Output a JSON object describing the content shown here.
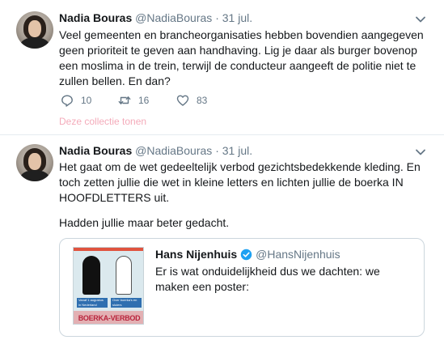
{
  "tweet1": {
    "name": "Nadia Bouras",
    "handle": "@NadiaBouras",
    "separator": "·",
    "date": "31 jul.",
    "text": "Veel gemeenten en brancheorganisaties hebben bovendien aangegeven geen prioriteit te geven aan handhaving. Lig je daar als burger bovenop een moslima in de trein, terwijl de conducteur aangeeft de politie niet te zullen bellen. En dan?",
    "replies": "10",
    "retweets": "16",
    "likes": "83",
    "collection_link": "Deze collectie tonen"
  },
  "tweet2": {
    "name": "Nadia Bouras",
    "handle": "@NadiaBouras",
    "separator": "·",
    "date": "31 jul.",
    "text_p1": "Het gaat om de wet gedeeltelijk verbod gezichtsbedekkende kleding. En toch zetten jullie die wet in kleine letters en lichten jullie de boerka IN HOOFDLETTERS uit.",
    "text_p2": "Hadden jullie maar beter gedacht.",
    "quote": {
      "name": "Hans Nijenhuis",
      "handle": "@HansNijenhuis",
      "text": "Er is wat onduidelijkheid dus we dachten: we maken een poster:",
      "poster": {
        "label_left": "Vanaf 1 augustus in Nederland",
        "label_right": "Over boerka's en sluiers",
        "banner": "BOERKA-VERBOD"
      }
    }
  },
  "icons": {
    "reply": "reply-icon",
    "retweet": "retweet-icon",
    "like": "heart-icon",
    "menu": "chevron-down-icon",
    "verified": "verified-badge-icon"
  },
  "colors": {
    "link_pink": "#f4abba",
    "muted": "#657786",
    "verified_blue": "#1da1f2",
    "border": "#ccd6dd"
  }
}
